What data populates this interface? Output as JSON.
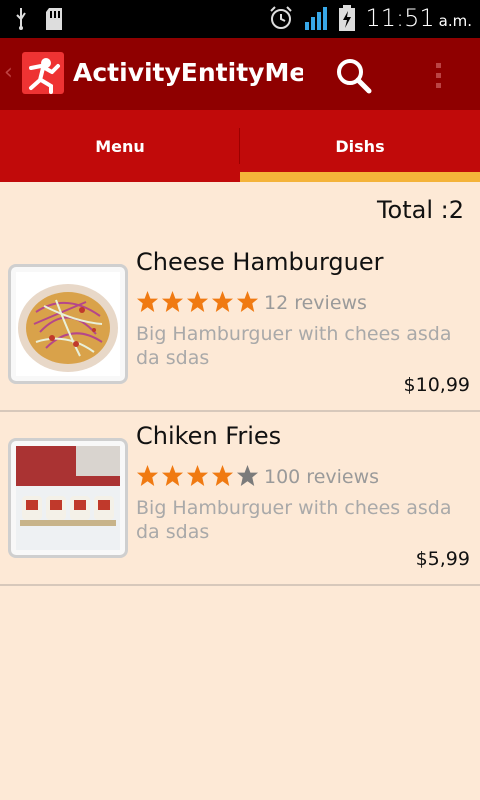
{
  "status_bar": {
    "time": "11:51",
    "ampm": "a.m."
  },
  "action_bar": {
    "title": "ActivityEntityMenu"
  },
  "tabs": [
    {
      "label": "Menu",
      "selected": false
    },
    {
      "label": "Dishs",
      "selected": true
    }
  ],
  "total_label": "Total :2",
  "items": [
    {
      "name": "Cheese Hamburguer",
      "rating": 5,
      "reviews": "12 reviews",
      "description": "Big Hamburguer with chees  asda da sdas",
      "price": "$10,99",
      "image_icon": "food-photo-icon"
    },
    {
      "name": "Chiken Fries",
      "rating": 4,
      "reviews": "100 reviews",
      "description": "Big Hamburguer with chees  asda da sdas",
      "price": "$5,99",
      "image_icon": "sushi-photo-icon"
    }
  ],
  "colors": {
    "action_bar": "#8f0000",
    "tabs": "#c10a0a",
    "tab_indicator": "#f4b33a",
    "background": "#fde9d6",
    "star_filled": "#f07a12",
    "star_empty": "#7b7b7b"
  }
}
